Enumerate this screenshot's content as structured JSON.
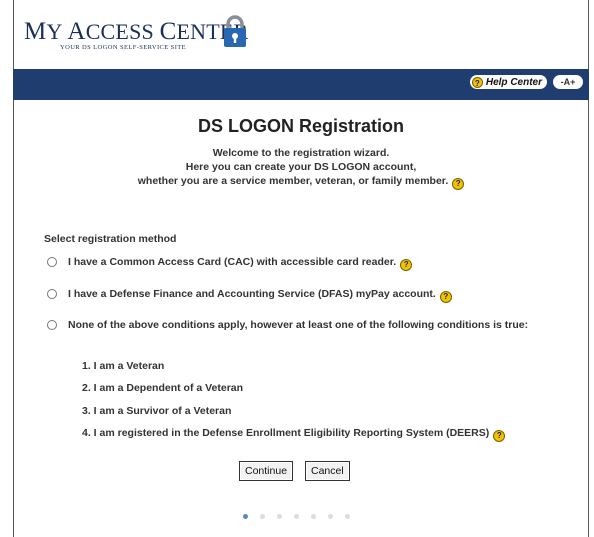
{
  "header": {
    "logo_title_first": "M",
    "logo_title_rest": "Y ",
    "logo_title_access_initial": "A",
    "logo_title_access_rest": "CCESS ",
    "logo_title_center_initial": "C",
    "logo_title_center_rest": "ENTER",
    "logo_subtitle": "YOUR DS LOGON SELF-SERVICE SITE"
  },
  "topbar": {
    "help_center_label": "Help Center",
    "help_icon_glyph": "?",
    "text_size_label": "-A+"
  },
  "main": {
    "title": "DS LOGON Registration",
    "intro_lines": [
      "Welcome to the registration wizard.",
      "Here you can create your DS LOGON account,",
      "whether you are a service member, veteran, or family member."
    ],
    "select_label": "Select registration method",
    "options": [
      {
        "label": "I have a Common Access Card (CAC) with accessible card reader.",
        "selected": false
      },
      {
        "label": "I have a Defense Finance and Accounting Service (DFAS) myPay account.",
        "selected": false
      },
      {
        "label": "None of the above conditions apply, however at least one of the following conditions is true:",
        "selected": false
      }
    ],
    "conditions": [
      "1.  I am a Veteran",
      "2.  I am a Dependent of a Veteran",
      "3.  I am a Survivor of a Veteran",
      "4.  I am registered in the Defense Enrollment Eligibility Reporting System (DEERS)"
    ],
    "continue_label": "Continue",
    "cancel_label": "Cancel",
    "help_glyph": "?"
  },
  "wizard": {
    "total_steps": 7,
    "current_step": 1
  },
  "colors": {
    "topbar": "#1f3d6e",
    "brand_text": "#1b2f57",
    "help_icon": "#f2c200",
    "active_dot": "#5c87c7"
  }
}
